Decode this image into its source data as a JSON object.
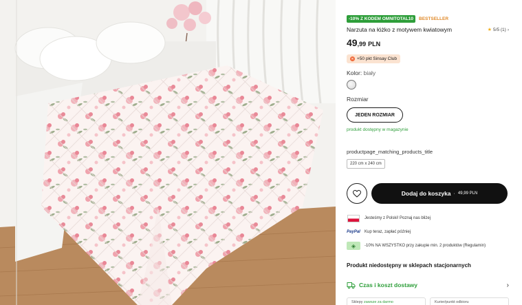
{
  "product": {
    "promo_badge": "-10% Z KODEM OMNITOTAL10",
    "bestseller": "BESTSELLER",
    "title": "Narzuta na łóżko z motywem kwiatowym",
    "rating": "5/5 (1)",
    "price_int": "49",
    "price_dec": ",99",
    "currency": "PLN",
    "club_text": "+50 pkt Sinsay Club",
    "color_label": "Kolor:",
    "color_value": "biały",
    "size_label": "Rozmiar",
    "size_option": "JEDEN ROZMIAR",
    "stock": "produkt dostępny w magazynie",
    "matching_title": "productpage_matching_products_title",
    "dimension": "220 cm x 240 cm",
    "add_to_cart": "Dodaj do koszyka",
    "cart_separator": "·",
    "cart_price": "49,99 PLN"
  },
  "perks": [
    {
      "icon": "poland-flag-icon",
      "text": "Jesteśmy z Polski! Poznaj nas bliżej"
    },
    {
      "icon": "paypal-icon",
      "icon_text": "PayPal",
      "text": "Kup teraz, zapłać później"
    },
    {
      "icon": "tag-icon",
      "text": "-10% NA WSZYSTKO przy zakupie min. 2 produktów (Regulamin)"
    }
  ],
  "store": {
    "unavailable": "Produkt niedostępny w sklepach stacjonarnych",
    "delivery": "Czas i koszt dostawy",
    "tab1_prefix": "Sklepy",
    "tab1_link": "zawsze za darmo",
    "tab2": "Kurier/punkt odbioru"
  },
  "colors": {
    "accent_green": "#2e9e3a",
    "bestseller_orange": "#e08a2a",
    "button_dark": "#111111",
    "club_bg": "#fbe3d1"
  }
}
